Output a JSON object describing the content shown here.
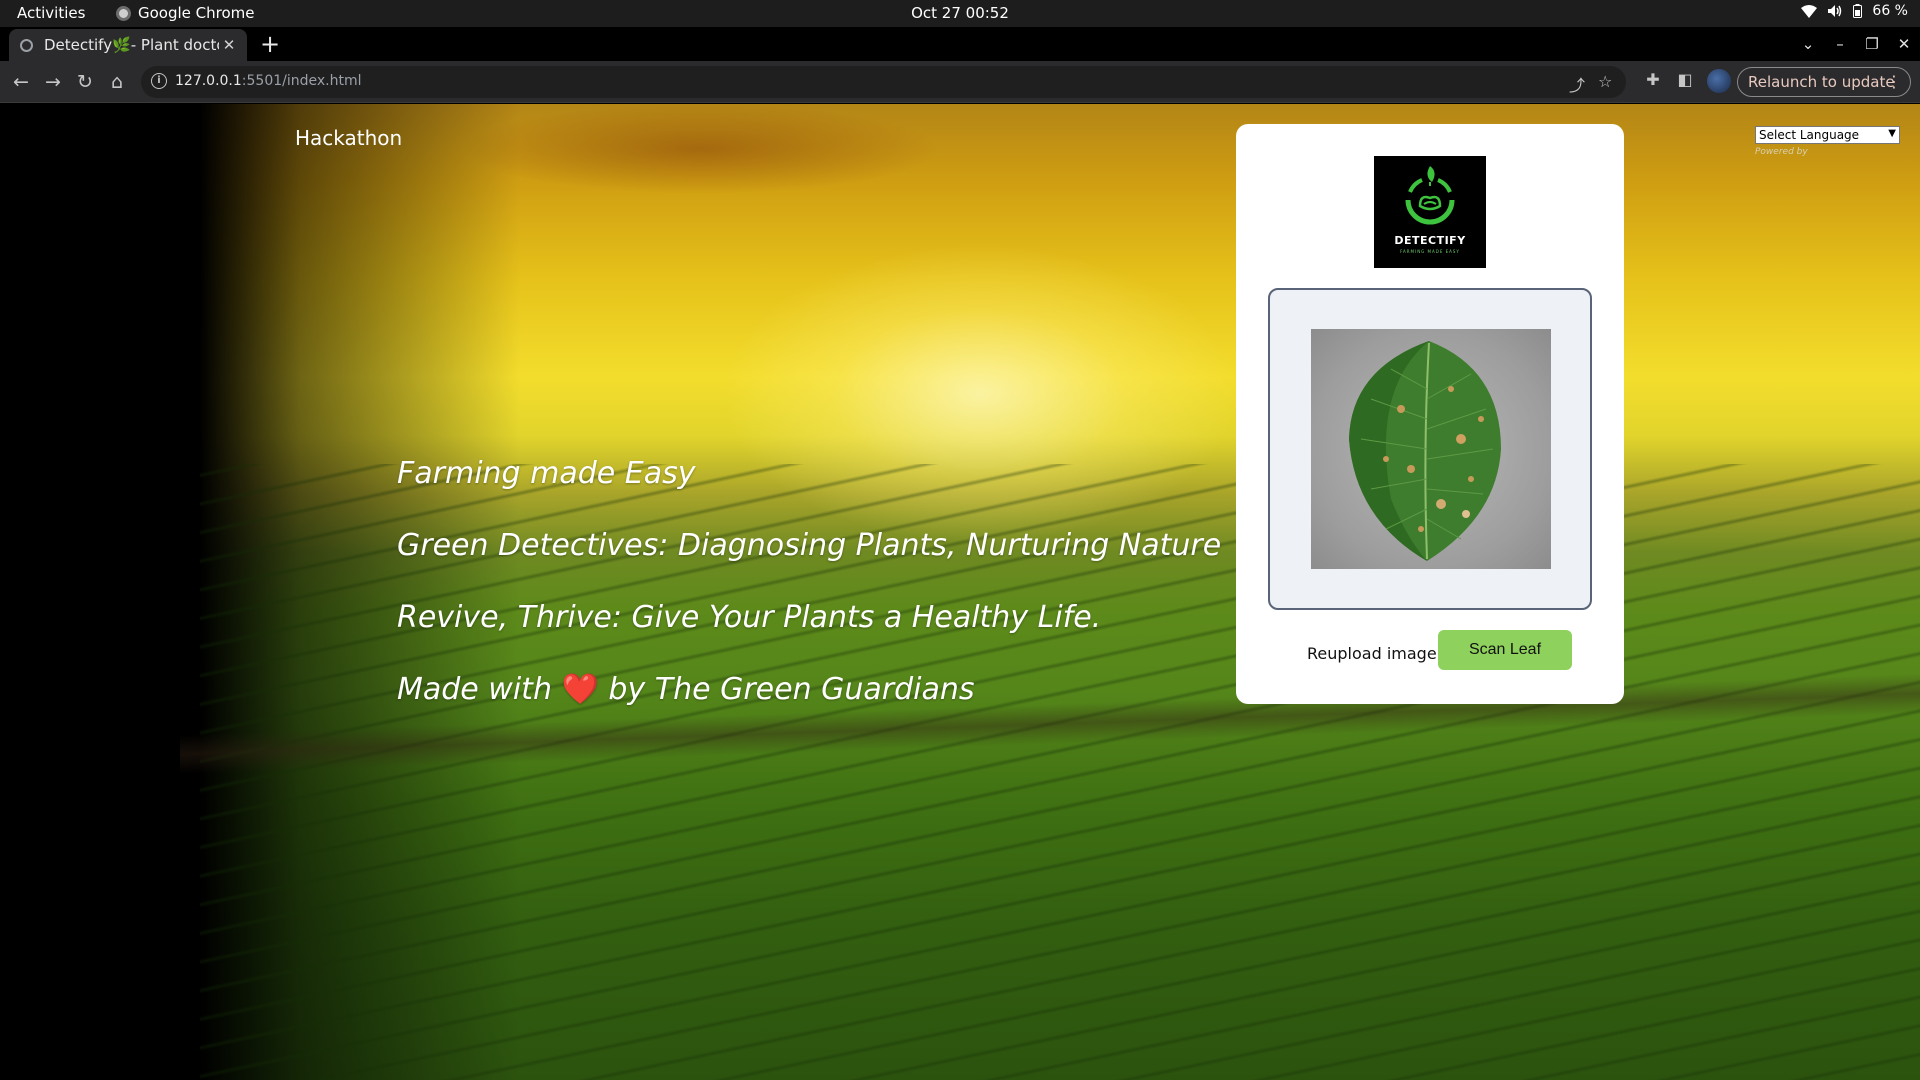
{
  "system_bar": {
    "activities": "Activities",
    "app_name": "Google Chrome",
    "datetime": "Oct 27  00:52",
    "battery": "66 %"
  },
  "browser": {
    "tab_title": "Detectify🌿- Plant doctor",
    "url_host": "127.0.0.1",
    "url_path": ":5501/index.html",
    "relaunch_label": "Relaunch to update"
  },
  "page": {
    "brand": "Hackathon",
    "taglines": [
      "Farming made Easy",
      "Green Detectives: Diagnosing Plants, Nurturing Nature",
      "Revive, Thrive: Give Your Plants a Healthy Life."
    ],
    "credit_prefix": "Made with",
    "credit_heart": "❤️",
    "credit_suffix": "by The Green Guardians",
    "logo_text": "DETECTIFY",
    "logo_subtext": "FARMING MADE EASY",
    "reupload_label": "Reupload image",
    "scan_button": "Scan Leaf",
    "language_select": "Select Language",
    "powered_by": "Powered by"
  },
  "colors": {
    "scan_button": "#8fd15d",
    "preview_border": "#5a6478",
    "relaunch_text": "#e8c9c0"
  }
}
